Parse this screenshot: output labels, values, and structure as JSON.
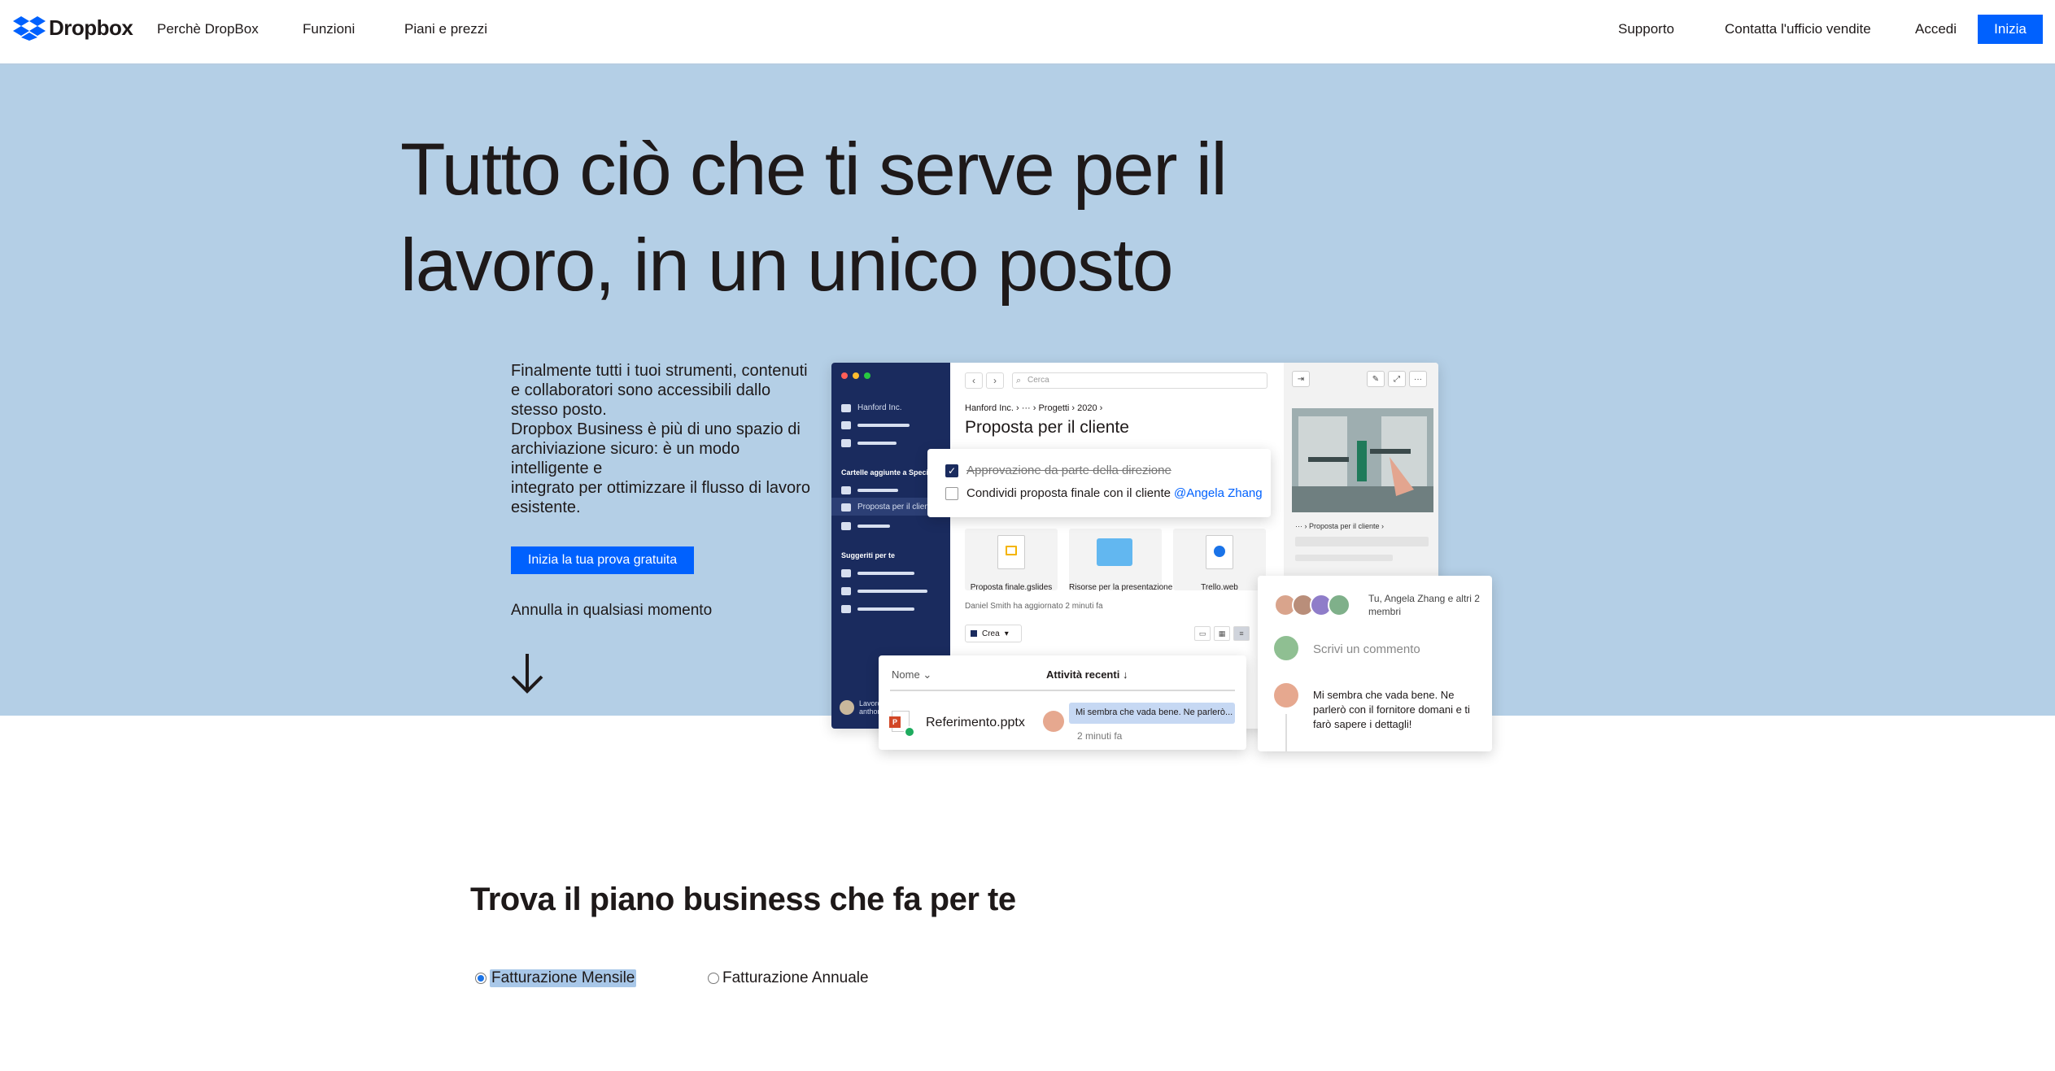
{
  "nav": {
    "brand": "Dropbox",
    "links": [
      "Perchè DropBox",
      "Funzioni",
      "Piani e prezzi"
    ],
    "right_links": [
      "Supporto",
      "Contatta l'ufficio vendite",
      "Accedi"
    ],
    "cta": "Inizia"
  },
  "hero": {
    "title": "Tutto ciò che ti serve per il lavoro, in un unico posto",
    "desc_lines": [
      "Finalmente tutti i tuoi strumenti, contenuti e collaboratori sono accessibili dallo stesso posto.",
      "Dropbox Business è più di uno spazio di archiviazione sicuro: è un modo intelligente e",
      "integrato per ottimizzare il flusso di lavoro esistente."
    ],
    "cta": "Inizia la tua prova gratuita",
    "cancel": "Annulla in qualsiasi momento"
  },
  "mockup": {
    "sidebar": {
      "team": "Hanford Inc.",
      "section_shared": "Cartelle aggiunte a Speciali",
      "selected_folder": "Proposta per il cliente",
      "section_suggested": "Suggeriti per te",
      "footer_name": "Lavoro",
      "footer_sub": "anthony..."
    },
    "search_placeholder": "Cerca",
    "breadcrumb": "Hanford Inc.  ›  ···  ›  Progetti  ›  2020  ›",
    "folder_title": "Proposta per il cliente",
    "checklist": [
      {
        "text": "Approvazione da parte della direzione",
        "done": true
      },
      {
        "text": "Condividi proposta finale con il cliente",
        "mention": "@Angela Zhang",
        "done": false
      }
    ],
    "tiles": [
      "Proposta finale.gslides",
      "Risorse per la presentazione",
      "Trello.web"
    ],
    "updated": "Daniel Smith ha aggiornato 2 minuti fa",
    "create_label": "Crea",
    "preview_breadcrumb": "···  ›  Proposta per il cliente  ›",
    "filelist": {
      "col_name": "Nome",
      "col_activity": "Attività recenti",
      "file": "Referimento.pptx",
      "comment": "Mi sembra che vada bene. Ne parlerò...",
      "time": "2 minuti fa"
    },
    "comments": {
      "members": "Tu, Angela Zhang e altri 2 membri",
      "input_placeholder": "Scrivi un commento",
      "comment": "Mi sembra che vada bene. Ne parlerò con il fornitore domani e ti farò sapere i dettagli!"
    }
  },
  "plans": {
    "title": "Trova il piano business che fa per te",
    "billing_monthly": "Fatturazione Mensile",
    "billing_annual": "Fatturazione Annuale",
    "selected": "monthly"
  },
  "colors": {
    "accent": "#0061fe",
    "hero_bg": "#b4cfe6",
    "sidebar": "#1a2b5e"
  }
}
